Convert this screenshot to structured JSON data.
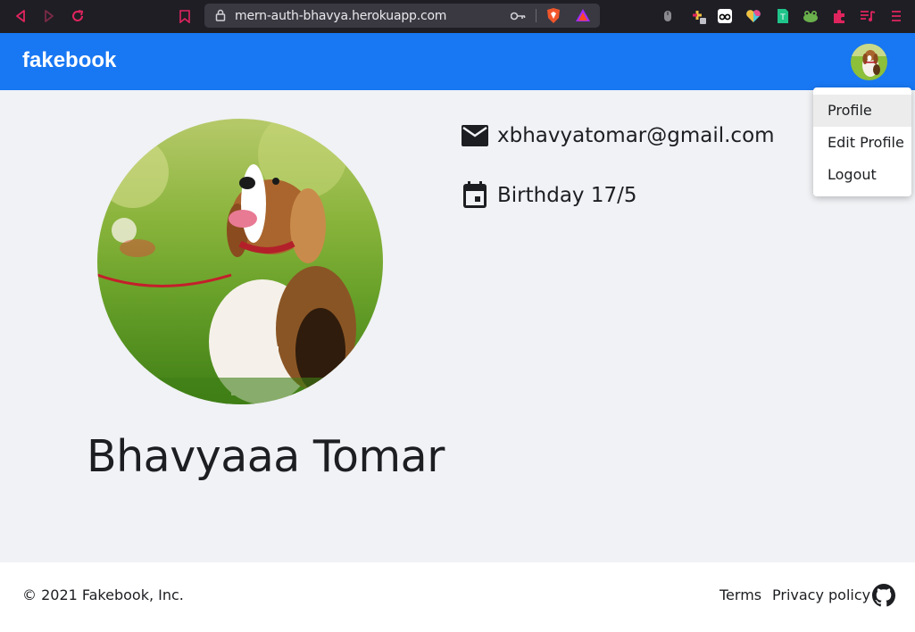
{
  "browser": {
    "url": "mern-auth-bhavya.herokuapp.com",
    "colors": {
      "toolbar": "#1f1e25",
      "urlbar": "#3a3942",
      "nav_icon": "#e0245e"
    },
    "nav_icons": [
      "back-icon",
      "forward-icon",
      "reload-icon",
      "bookmark-icon"
    ],
    "extension_icons": [
      "key-icon",
      "brave-shields-icon",
      "brave-rewards-icon",
      "mouse-icon",
      "puzzle-extension-icon",
      "glasses-extension-icon",
      "heart-extension-icon",
      "green-extension-icon",
      "frog-extension-icon",
      "extensions-icon",
      "playlist-icon",
      "menu-icon"
    ]
  },
  "header": {
    "brand": "fakebook",
    "color": "#1877f2"
  },
  "dropdown": {
    "items": [
      {
        "label": "Profile"
      },
      {
        "label": "Edit Profile"
      },
      {
        "label": "Logout"
      }
    ]
  },
  "profile": {
    "name": "Bhavyaaa Tomar",
    "email": "xbhavyatomar@gmail.com",
    "birthday": "Birthday 17/5",
    "photo_icon": "beagle-dog-photo"
  },
  "footer": {
    "copyright": "© 2021 Fakebook, Inc.",
    "links": {
      "terms": "Terms",
      "privacy": "Privacy policy"
    },
    "github_icon": "github-icon"
  }
}
